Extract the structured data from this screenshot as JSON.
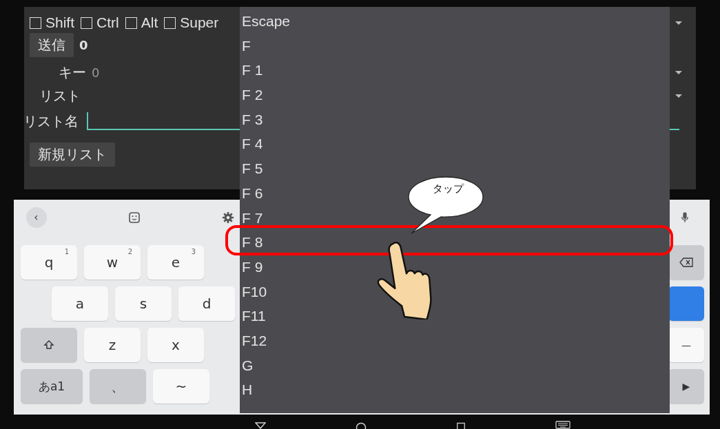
{
  "panel": {
    "modifiers": [
      {
        "label": "Shift",
        "checked": false
      },
      {
        "label": "Ctrl",
        "checked": false
      },
      {
        "label": "Alt",
        "checked": false
      },
      {
        "label": "Super",
        "checked": false
      }
    ],
    "send_button": "送信",
    "send_value": "0",
    "key_label": "キー",
    "key_value": "0",
    "list_label": "リスト",
    "list_name_label": "リスト名",
    "new_list_button": "新規リスト"
  },
  "dropdown": {
    "items": [
      "Escape",
      "F",
      "F 1",
      "F 2",
      "F 3",
      "F 4",
      "F 5",
      "F 6",
      "F 7",
      "F 8",
      "F 9",
      "F10",
      "F11",
      "F12",
      "G",
      "H"
    ]
  },
  "keyboard": {
    "rows": [
      [
        {
          "label": "q",
          "sup": "1",
          "kind": "letter"
        },
        {
          "label": "w",
          "sup": "2",
          "kind": "letter"
        },
        {
          "label": "e",
          "sup": "3",
          "kind": "letter"
        },
        {
          "kind": "backspace"
        }
      ],
      [
        {
          "label": "a",
          "kind": "letter"
        },
        {
          "label": "s",
          "kind": "letter"
        },
        {
          "label": "d",
          "kind": "letter"
        },
        {
          "kind": "enter"
        }
      ],
      [
        {
          "kind": "shift"
        },
        {
          "label": "z",
          "kind": "letter"
        },
        {
          "label": "x",
          "kind": "letter"
        },
        {
          "label": "—",
          "kind": "letter"
        }
      ],
      [
        {
          "label": "あa1",
          "kind": "function"
        },
        {
          "label": "、",
          "kind": "function"
        },
        {
          "label": "~",
          "kind": "letter"
        },
        {
          "label": "▶",
          "kind": "function"
        }
      ]
    ]
  },
  "annotation": {
    "callout": "タップ"
  }
}
